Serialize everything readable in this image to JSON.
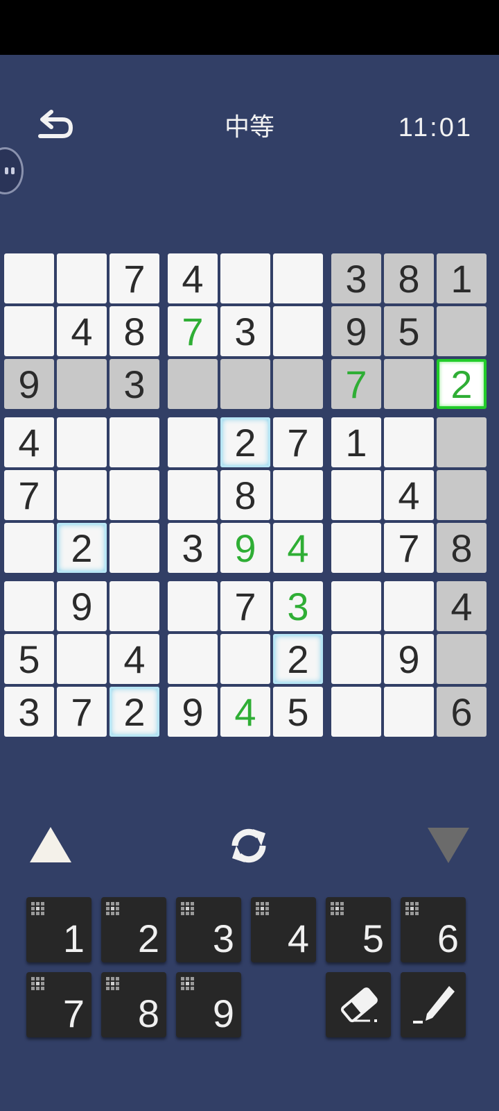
{
  "header": {
    "title": "中等",
    "timer": "11:01"
  },
  "board": {
    "cells": [
      [
        "",
        "",
        "7",
        "4",
        "",
        "",
        "3",
        "8",
        "1"
      ],
      [
        "",
        "4",
        "8",
        "7",
        "3",
        "",
        "9",
        "5",
        ""
      ],
      [
        "9",
        "",
        "3",
        "",
        "",
        "",
        "7",
        "",
        "2"
      ],
      [
        "4",
        "",
        "",
        "",
        "2",
        "7",
        "1",
        "",
        ""
      ],
      [
        "7",
        "",
        "",
        "",
        "8",
        "",
        "",
        "4",
        ""
      ],
      [
        "",
        "2",
        "",
        "3",
        "9",
        "4",
        "",
        "7",
        "8"
      ],
      [
        "",
        "9",
        "",
        "",
        "7",
        "3",
        "",
        "",
        "4"
      ],
      [
        "5",
        "",
        "4",
        "",
        "",
        "2",
        "",
        "9",
        ""
      ],
      [
        "3",
        "7",
        "2",
        "9",
        "4",
        "5",
        "",
        "",
        "6"
      ]
    ],
    "user_entered": [
      [
        1,
        3
      ],
      [
        2,
        6
      ],
      [
        2,
        8
      ],
      [
        5,
        4
      ],
      [
        5,
        5
      ],
      [
        6,
        5
      ],
      [
        8,
        4
      ]
    ],
    "selected": [
      2,
      8
    ],
    "same_value_highlight": [
      [
        3,
        4
      ],
      [
        5,
        1
      ],
      [
        7,
        5
      ],
      [
        8,
        2
      ]
    ],
    "colors": {
      "background": "#323f66",
      "cell": "#f6f6f6",
      "highlight": "#c8c8c8",
      "user_digit": "#2fae35",
      "selected_border": "#22cc2a",
      "same_glow": "#3dbbe6"
    }
  },
  "controls": {
    "prev_icon": "triangle-up-icon",
    "rotate_icon": "rotate-icon",
    "next_icon": "triangle-down-icon"
  },
  "keypad": {
    "digits": [
      "1",
      "2",
      "3",
      "4",
      "5",
      "6",
      "7",
      "8",
      "9"
    ],
    "erase_icon": "eraser-icon",
    "pencil_icon": "pencil-icon"
  }
}
